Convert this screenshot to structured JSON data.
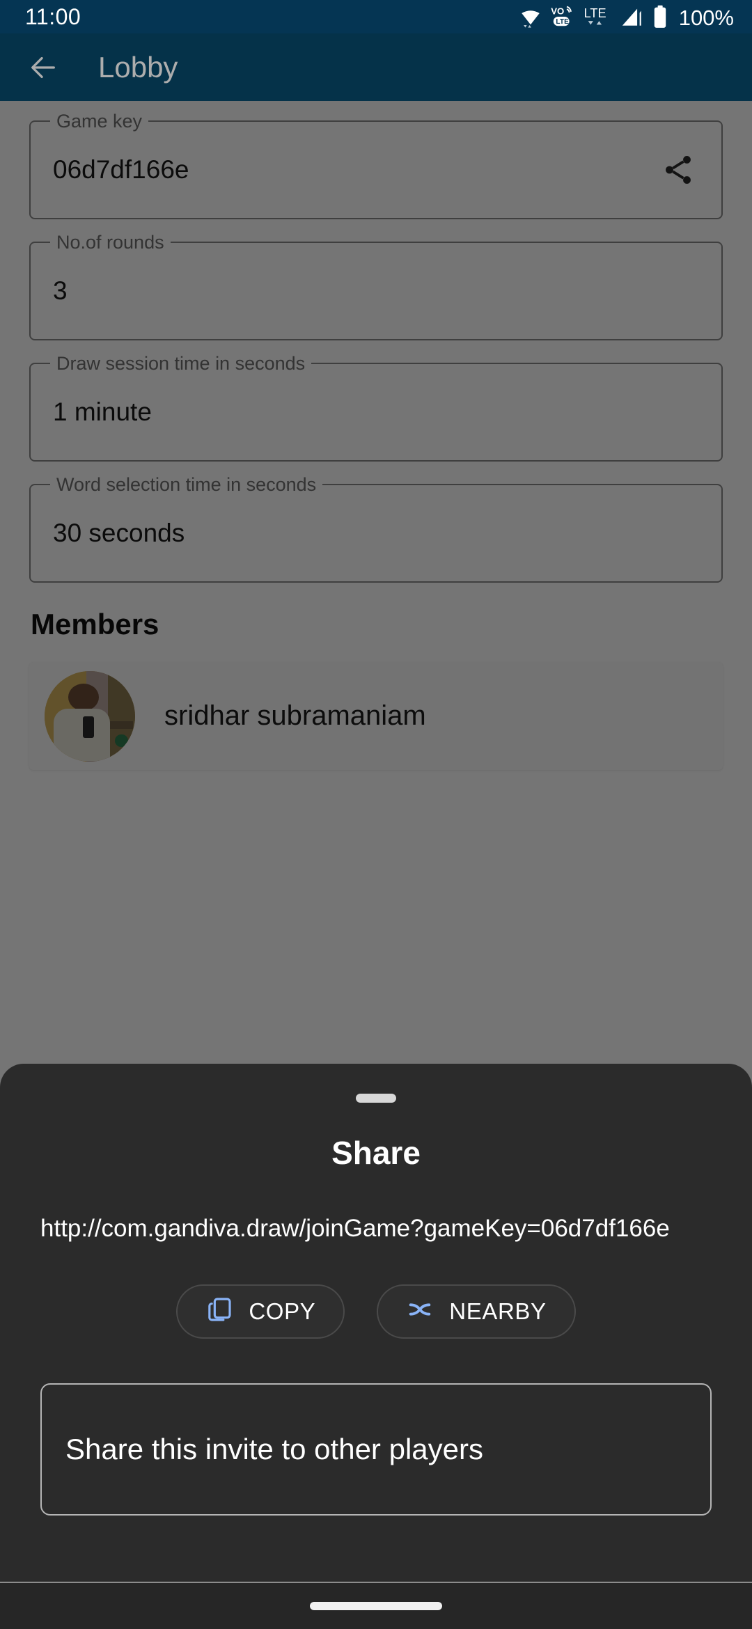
{
  "status_bar": {
    "time": "11:00",
    "battery_percent": "100%",
    "icons": [
      "wifi-icon",
      "volte-icon",
      "lte-icon",
      "signal-icon",
      "battery-icon"
    ],
    "network_label": "LTE",
    "volte_label": "VoLTE",
    "background_color": "#053553"
  },
  "app_bar": {
    "title": "Lobby",
    "back_icon": "arrow-left-icon",
    "background_color": "#084b6c"
  },
  "form": {
    "fields": [
      {
        "label": "Game key",
        "value": "06d7df166e",
        "action_icon": "share-icon"
      },
      {
        "label": "No.of rounds",
        "value": "3",
        "action_icon": ""
      },
      {
        "label": "Draw session time in seconds",
        "value": "1 minute",
        "action_icon": ""
      },
      {
        "label": "Word selection time in seconds",
        "value": "30 seconds",
        "action_icon": ""
      }
    ]
  },
  "members": {
    "heading": "Members",
    "list": [
      {
        "name": "sridhar subramaniam",
        "avatar": "user-photo-avatar"
      }
    ]
  },
  "share_sheet": {
    "handle": "drag-handle",
    "title": "Share",
    "url": "http://com.gandiva.draw/joinGame?gameKey=06d7df166e",
    "actions": [
      {
        "label": "COPY",
        "icon": "copy-icon",
        "icon_color": "#8ab4f8"
      },
      {
        "label": "NEARBY",
        "icon": "nearby-share-icon",
        "icon_color": "#8ab4f8"
      }
    ],
    "invite_text": "Share this invite to other players",
    "background_color": "#2b2b2b"
  },
  "nav_bar": {
    "pill": "home-gesture-pill"
  }
}
